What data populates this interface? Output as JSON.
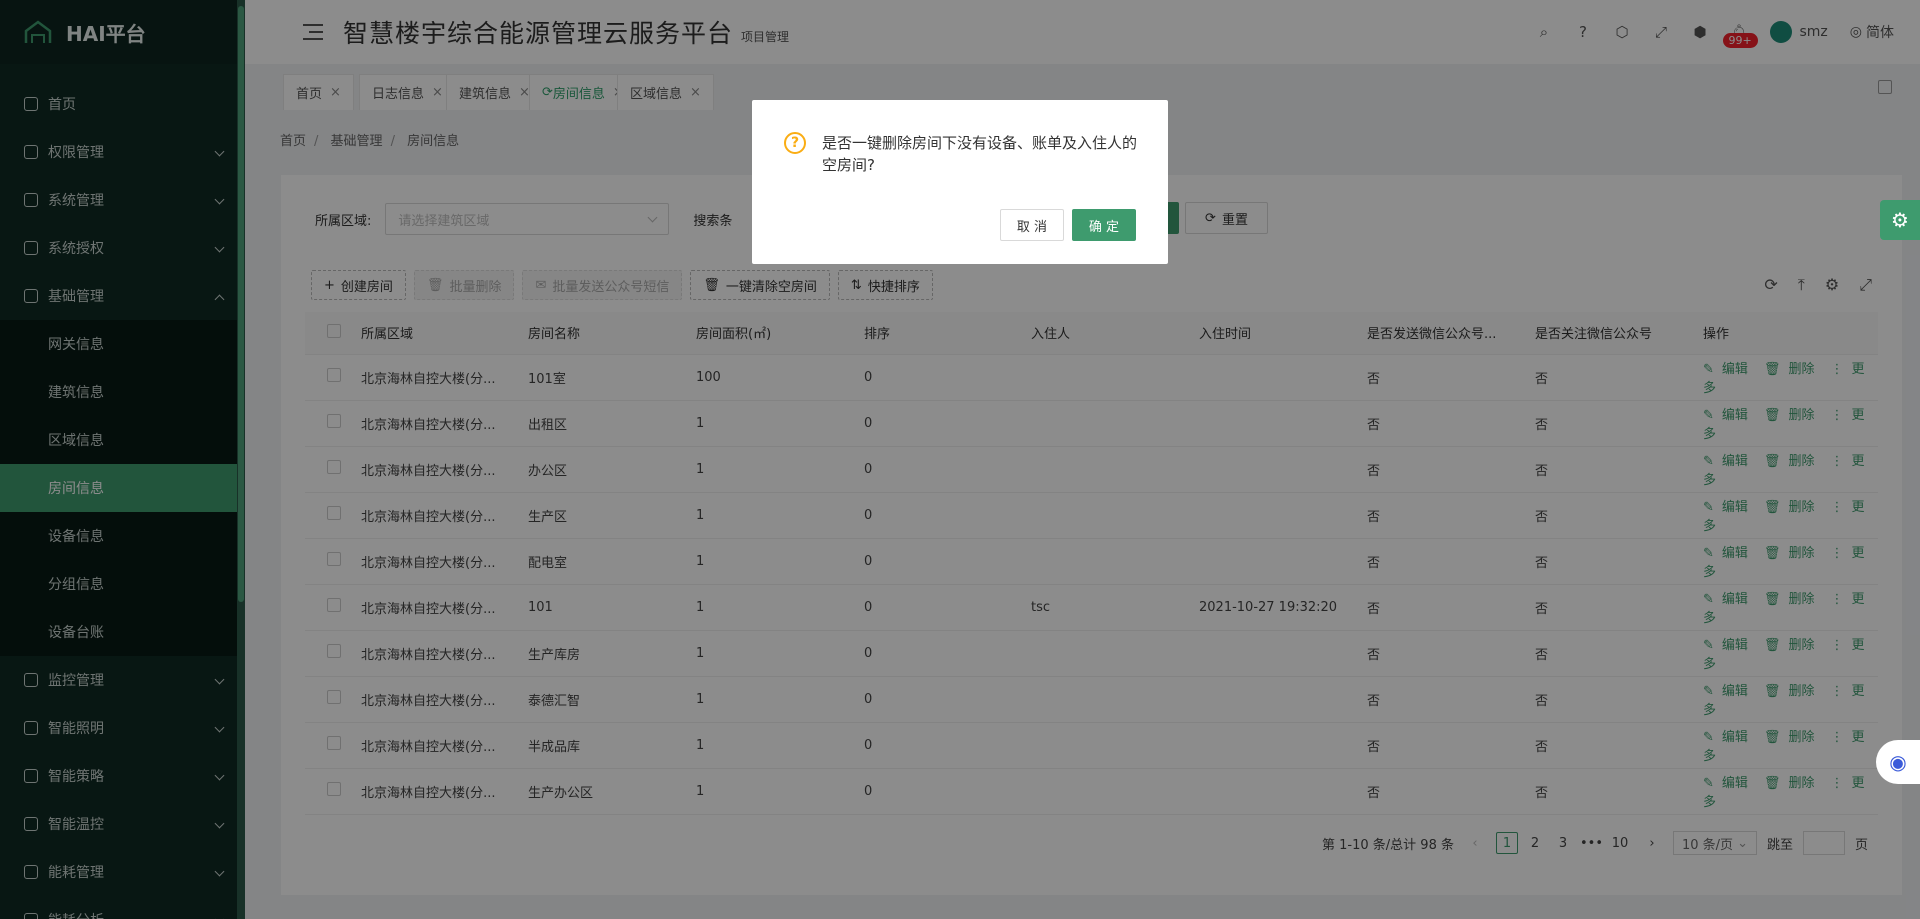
{
  "app": {
    "logo_text": "HAI平台",
    "title": "智慧楼宇综合能源管理云服务平台",
    "subtitle": "项目管理",
    "accent": "#3e9b6e"
  },
  "header": {
    "badge": "99+",
    "user": "smz",
    "lang": "简体"
  },
  "sidebar": {
    "items": [
      {
        "label": "首页",
        "icon": "dashboard-icon"
      },
      {
        "label": "权限管理",
        "icon": "shield-icon"
      },
      {
        "label": "系统管理",
        "icon": "monitor-icon"
      },
      {
        "label": "系统授权",
        "icon": "edit-icon"
      },
      {
        "label": "基础管理",
        "icon": "table-icon"
      }
    ],
    "sub_items": [
      "网关信息",
      "建筑信息",
      "区域信息",
      "房间信息",
      "设备信息",
      "分组信息",
      "设备台账"
    ],
    "bottom_items": [
      "监控管理",
      "智能照明",
      "智能策略",
      "智能温控",
      "能耗管理",
      "能耗分析"
    ]
  },
  "tabs": [
    "首页",
    "日志信息",
    "建筑信息",
    "房间信息",
    "区域信息"
  ],
  "breadcrumb": [
    "首页",
    "基础管理",
    "房间信息"
  ],
  "form": {
    "area_label": "所属区域:",
    "area_placeholder": "请选择建筑区域",
    "search_label": "搜索条",
    "reset": "重置"
  },
  "toolbar": {
    "create": "创建房间",
    "batch_delete": "批量删除",
    "batch_sms": "批量发送公众号短信",
    "clear_empty": "一键清除空房间",
    "quick_sort": "快捷排序"
  },
  "table": {
    "headers": [
      "所属区域",
      "房间名称",
      "房间面积(㎡)",
      "排序",
      "入住人",
      "入住时间",
      "是否发送微信公众号...",
      "是否关注微信公众号",
      "操作"
    ],
    "rows": [
      [
        "北京海林自控大楼(分...",
        "101室",
        "100",
        "0",
        "",
        "",
        "否",
        "否"
      ],
      [
        "北京海林自控大楼(分...",
        "出租区",
        "1",
        "0",
        "",
        "",
        "否",
        "否"
      ],
      [
        "北京海林自控大楼(分...",
        "办公区",
        "1",
        "0",
        "",
        "",
        "否",
        "否"
      ],
      [
        "北京海林自控大楼(分...",
        "生产区",
        "1",
        "0",
        "",
        "",
        "否",
        "否"
      ],
      [
        "北京海林自控大楼(分...",
        "配电室",
        "1",
        "0",
        "",
        "",
        "否",
        "否"
      ],
      [
        "北京海林自控大楼(分...",
        "101",
        "1",
        "0",
        "tsc",
        "2021-10-27 19:32:20",
        "否",
        "否"
      ],
      [
        "北京海林自控大楼(分...",
        "生产库房",
        "1",
        "0",
        "",
        "",
        "否",
        "否"
      ],
      [
        "北京海林自控大楼(分...",
        "泰德汇智",
        "1",
        "0",
        "",
        "",
        "否",
        "否"
      ],
      [
        "北京海林自控大楼(分...",
        "半成品库",
        "1",
        "0",
        "",
        "",
        "否",
        "否"
      ],
      [
        "北京海林自控大楼(分...",
        "生产办公区",
        "1",
        "0",
        "",
        "",
        "否",
        "否"
      ]
    ],
    "ops": {
      "edit": "编辑",
      "delete": "删除",
      "more": "更多"
    }
  },
  "pager": {
    "summary": "第 1-10 条/总计 98 条",
    "pages": [
      "1",
      "2",
      "3",
      "•••",
      "10"
    ],
    "size": "10 条/页",
    "jump": "跳至",
    "page_unit": "页"
  },
  "modal": {
    "message": "是否一键删除房间下没有设备、账单及入住人的空房间?",
    "cancel": "取 消",
    "ok": "确 定"
  }
}
